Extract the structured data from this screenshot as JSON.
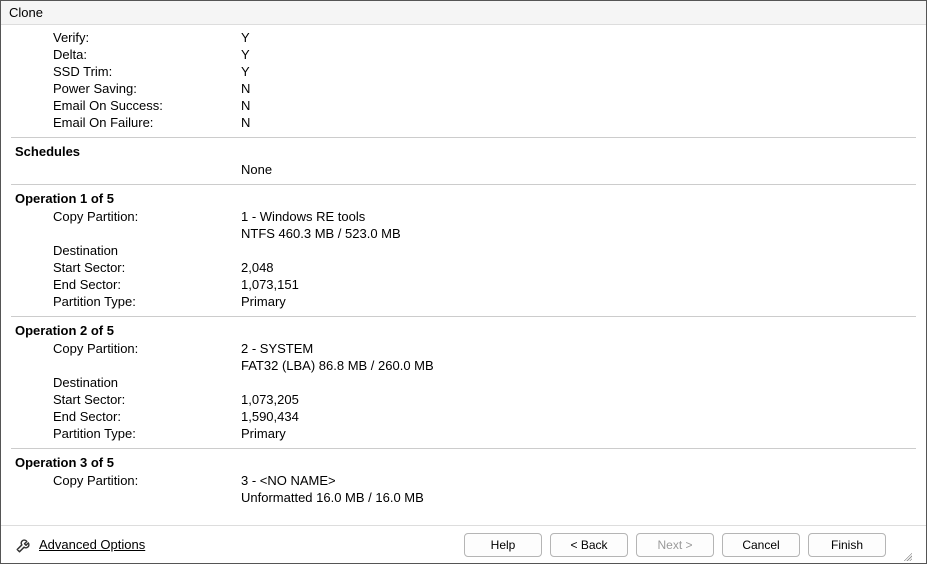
{
  "window": {
    "title": "Clone"
  },
  "settings": [
    {
      "key": "Verify:",
      "val": "Y"
    },
    {
      "key": "Delta:",
      "val": "Y"
    },
    {
      "key": "SSD Trim:",
      "val": "Y"
    },
    {
      "key": "Power Saving:",
      "val": "N"
    },
    {
      "key": "Email On Success:",
      "val": "N"
    },
    {
      "key": "Email On Failure:",
      "val": "N"
    }
  ],
  "schedules": {
    "title": "Schedules",
    "value": "None"
  },
  "operations": [
    {
      "title": "Operation 1 of 5",
      "copy_label": "Copy Partition:",
      "copy_line1": "1 - Windows RE tools",
      "copy_line2": "NTFS 460.3 MB / 523.0 MB",
      "dest_label": "Destination",
      "rows": [
        {
          "key": "Start Sector:",
          "val": "2,048"
        },
        {
          "key": "End Sector:",
          "val": "1,073,151"
        },
        {
          "key": "Partition Type:",
          "val": "Primary"
        }
      ]
    },
    {
      "title": "Operation 2 of 5",
      "copy_label": "Copy Partition:",
      "copy_line1": "2 - SYSTEM",
      "copy_line2": "FAT32 (LBA) 86.8 MB / 260.0 MB",
      "dest_label": "Destination",
      "rows": [
        {
          "key": "Start Sector:",
          "val": "1,073,205"
        },
        {
          "key": "End Sector:",
          "val": "1,590,434"
        },
        {
          "key": "Partition Type:",
          "val": "Primary"
        }
      ]
    },
    {
      "title": "Operation 3 of 5",
      "copy_label": "Copy Partition:",
      "copy_line1": "3 - <NO NAME>",
      "copy_line2": "Unformatted 16.0 MB / 16.0 MB",
      "dest_label": "",
      "rows": []
    }
  ],
  "footer": {
    "advanced": "Advanced Options",
    "help": "Help",
    "back": "< Back",
    "next": "Next >",
    "cancel": "Cancel",
    "finish": "Finish"
  }
}
